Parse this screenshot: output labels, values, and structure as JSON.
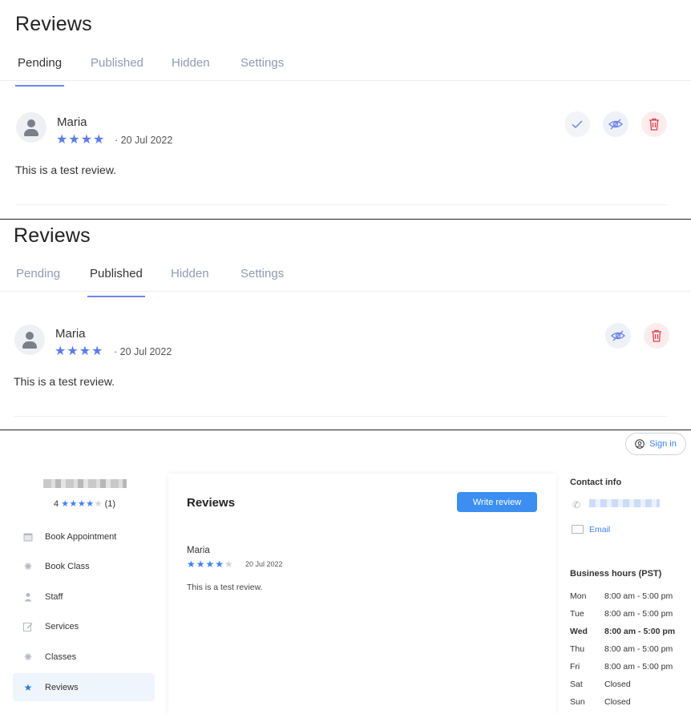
{
  "panel_pending": {
    "title": "Reviews",
    "tabs": [
      "Pending",
      "Published",
      "Hidden",
      "Settings"
    ],
    "active_tab": "Pending",
    "review": {
      "name": "Maria",
      "stars": "★★★★",
      "date": "· 20 Jul 2022",
      "text": "This is a test review."
    },
    "actions": [
      "approve-icon",
      "hide-icon",
      "delete-icon"
    ]
  },
  "panel_published": {
    "title": "Reviews",
    "tabs": [
      "Pending",
      "Published",
      "Hidden",
      "Settings"
    ],
    "active_tab": "Published",
    "review": {
      "name": "Maria",
      "stars": "★★★★",
      "date": "· 20 Jul 2022",
      "text": "This is a test review."
    },
    "actions": [
      "hide-icon",
      "delete-icon"
    ]
  },
  "booking_page": {
    "signin_label": "Sign in",
    "rating": {
      "value": "4",
      "stars_on": "★★★★",
      "stars_off": "★",
      "count": "(1)"
    },
    "sidebar": [
      {
        "label": "Book Appointment",
        "icon": "calendar-icon"
      },
      {
        "label": "Book Class",
        "icon": "class-icon"
      },
      {
        "label": "Staff",
        "icon": "person-icon"
      },
      {
        "label": "Services",
        "icon": "edit-icon"
      },
      {
        "label": "Classes",
        "icon": "class-icon"
      },
      {
        "label": "Reviews",
        "icon": "star-icon",
        "active": true
      }
    ],
    "reviews_card": {
      "title": "Reviews",
      "write_button": "Write review",
      "review": {
        "name": "Maria",
        "stars_on": "★★★★",
        "stars_off": "★",
        "date": "20 Jul 2022",
        "text": "This is a test review."
      }
    },
    "contact": {
      "title": "Contact info",
      "email_label": "Email"
    },
    "hours": {
      "title": "Business hours (PST)",
      "rows": [
        {
          "day": "Mon",
          "time": "8:00 am - 5:00 pm"
        },
        {
          "day": "Tue",
          "time": "8:00 am - 5:00 pm"
        },
        {
          "day": "Wed",
          "time": "8:00 am - 5:00 pm",
          "today": true
        },
        {
          "day": "Thu",
          "time": "8:00 am - 5:00 pm"
        },
        {
          "day": "Fri",
          "time": "8:00 am - 5:00 pm"
        },
        {
          "day": "Sat",
          "time": "Closed"
        },
        {
          "day": "Sun",
          "time": "Closed"
        }
      ]
    }
  },
  "colors": {
    "accent": "#6f86e8",
    "star": "#5b7de6",
    "primary_button": "#3c8ff0",
    "delete": "#e0404a"
  }
}
